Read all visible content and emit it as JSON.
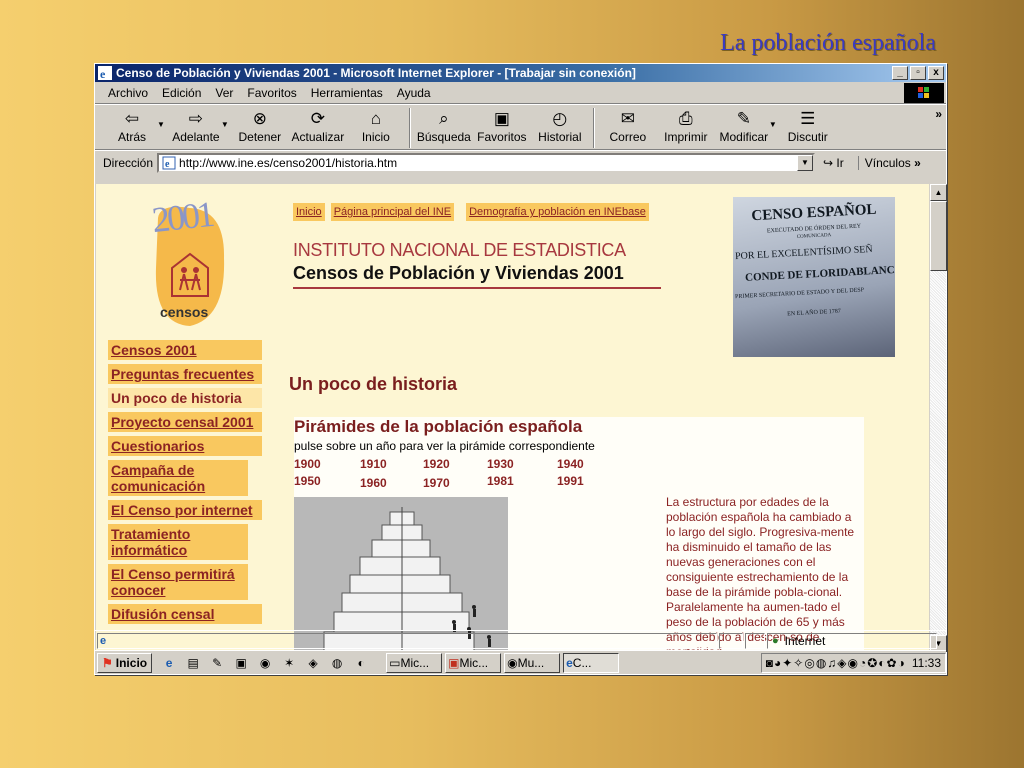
{
  "slide": {
    "title": "La población española"
  },
  "window": {
    "title": "Censo de Población y Viviendas 2001 - Microsoft Internet Explorer - [Trabajar sin conexión]",
    "minimize": "_",
    "restore": "▫",
    "close": "x"
  },
  "menu": [
    "Archivo",
    "Edición",
    "Ver",
    "Favoritos",
    "Herramientas",
    "Ayuda"
  ],
  "toolbar": {
    "back": "Atrás",
    "forward": "Adelante",
    "stop": "Detener",
    "refresh": "Actualizar",
    "home": "Inicio",
    "search": "Búsqueda",
    "favorites": "Favoritos",
    "history": "Historial",
    "mail": "Correo",
    "print": "Imprimir",
    "edit": "Modificar",
    "discuss": "Discutir",
    "more": "»"
  },
  "address": {
    "label": "Dirección",
    "url": "http://www.ine.es/censo2001/historia.htm",
    "go": "Ir",
    "links": "Vínculos",
    "more": "»"
  },
  "page": {
    "logo_year": "2001",
    "logo_word": "censos",
    "topnav": [
      "Inicio",
      "Página principal del INE",
      "Demografía y población en INEbase"
    ],
    "ine_line1": "INSTITUTO NACIONAL DE ESTADISTICA",
    "ine_line2": "Censos de Población y Viviendas 2001",
    "photo_lines": [
      "CENSO ESPAÑOL",
      "EXECUTADO DE ÓRDEN DEL REY",
      "COMUNICADA",
      "POR EL EXCELENTÍSIMO SEÑ",
      "CONDE DE FLORIDABLANCA,",
      "PRIMER SECRETARIO DE ESTADO Y DEL DESP",
      "EN EL AÑO DE 1787"
    ],
    "sidenav": [
      {
        "label": "Censos 2001"
      },
      {
        "label": "Preguntas frecuentes"
      },
      {
        "label": "Un poco de historia"
      },
      {
        "label": "Proyecto censal 2001"
      },
      {
        "label": "Cuestionarios"
      },
      {
        "label": "Campaña de comunicación"
      },
      {
        "label": "El Censo por internet"
      },
      {
        "label": "Tratamiento informático"
      },
      {
        "label": "El Censo permitirá conocer"
      },
      {
        "label": "Difusión censal"
      }
    ],
    "heading": "Un poco de historia",
    "pyramids_title": "Pirámides de la población española",
    "pyramids_sub": "pulse sobre un año para ver la pirámide correspondiente",
    "years": [
      "1900",
      "1910",
      "1920",
      "1930",
      "1940",
      "1950",
      "1960",
      "1970",
      "1981",
      "1991"
    ],
    "description": "La estructura por edades de la población española ha cambiado a lo largo del siglo. Progresiva-mente ha disminuido el tamaño de las nuevas generaciones con el consiguiente estrechamiento de la base de la pirámide pobla-cional. Paralelamente ha aumen-tado el peso de la población de 65 y más años debido al descen-so de mortalidad"
  },
  "status": {
    "zone": "Internet"
  },
  "taskbar": {
    "start": "Inicio",
    "tasks": [
      "Mic...",
      "Mic...",
      "Mu...",
      "C..."
    ],
    "clock": "11:33"
  }
}
